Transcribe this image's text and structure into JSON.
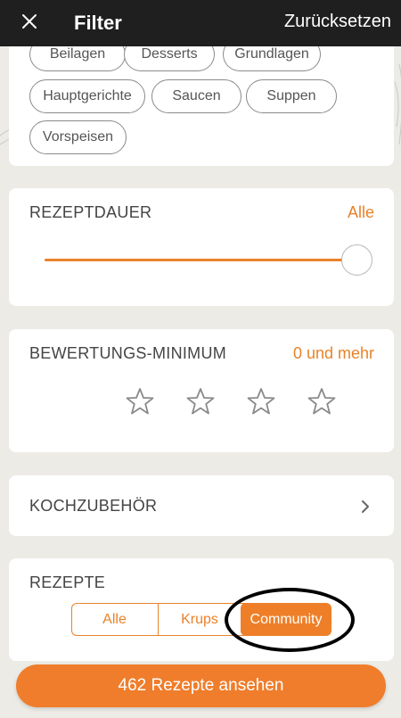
{
  "header": {
    "title": "Filter",
    "reset_label": "Zurücksetzen"
  },
  "categories": {
    "chips": [
      "Beilagen",
      "Desserts",
      "Grundlagen",
      "Hauptgerichte",
      "Saucen",
      "Suppen",
      "Vorspeisen"
    ]
  },
  "duration": {
    "label": "REZEPTDAUER",
    "value": "Alle",
    "slider_fraction": 1.0
  },
  "rating": {
    "label": "BEWERTUNGS-MINIMUM",
    "value": "0 und mehr",
    "stars_total": 4,
    "stars_filled": 0
  },
  "equipment": {
    "label": "KOCHZUBEHÖR"
  },
  "recipes": {
    "label": "REZEPTE",
    "options": [
      "Alle",
      "Krups",
      "Community"
    ],
    "selected": "Community"
  },
  "cta": {
    "label": "462 Rezepte ansehen"
  },
  "colors": {
    "accent": "#ef7d2b",
    "topbar": "#1f1f1f",
    "background": "#ecebe6"
  },
  "icons": [
    "close-icon",
    "chevron-right-icon",
    "star-outline-icon"
  ]
}
